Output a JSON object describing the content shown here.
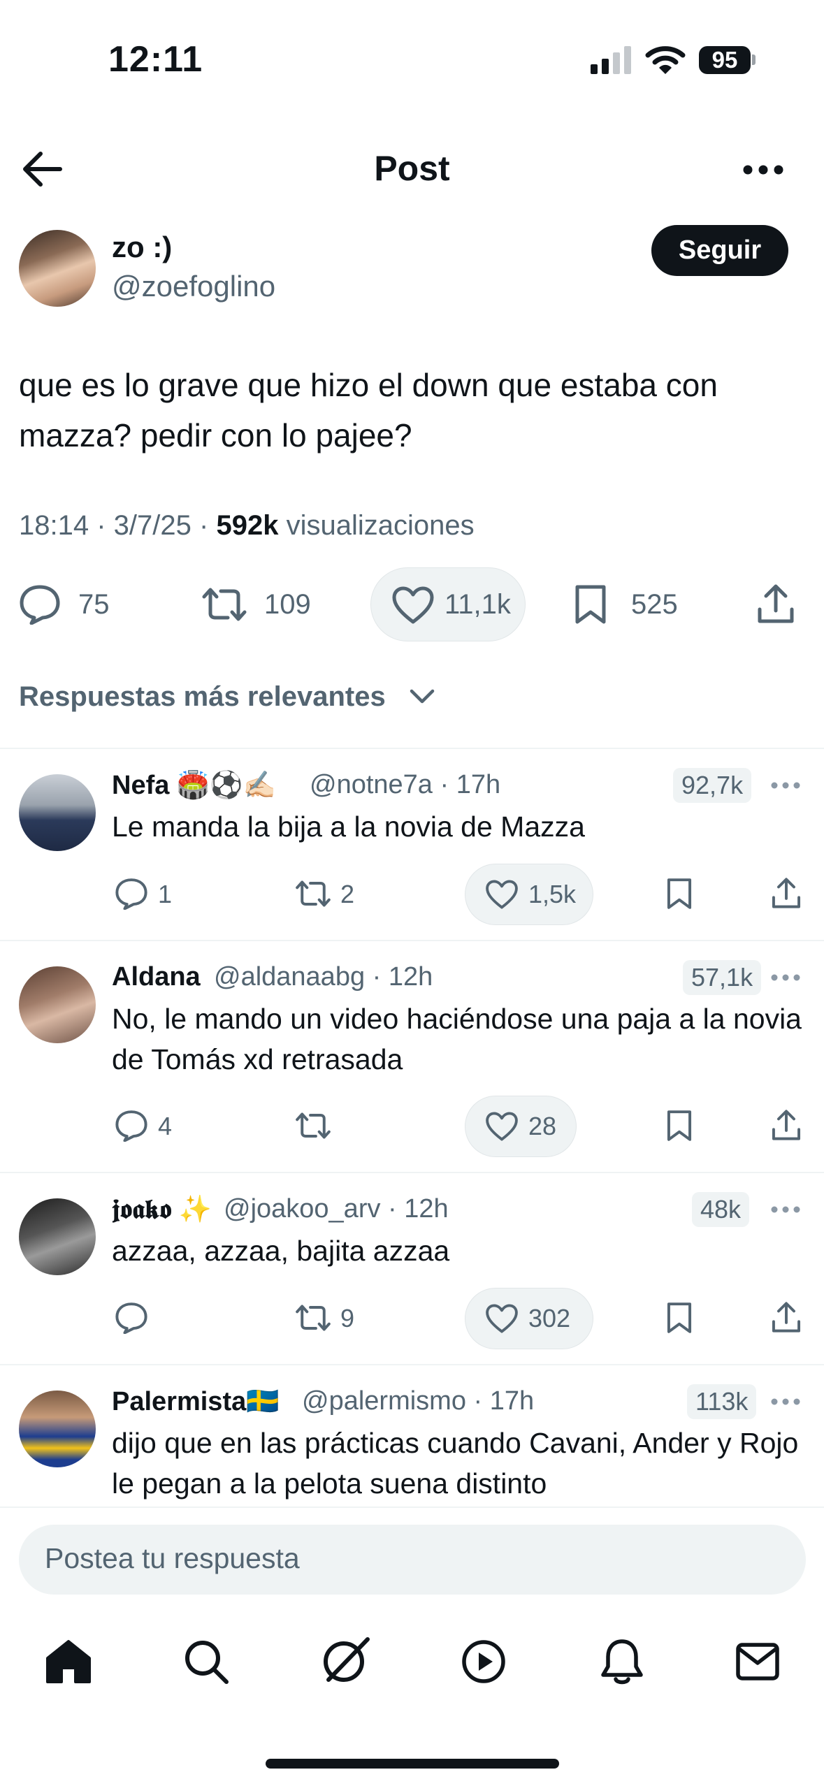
{
  "status_bar": {
    "time": "12:11",
    "battery": "95"
  },
  "header": {
    "title": "Post"
  },
  "post": {
    "author_name": "zo :)",
    "author_handle": "@zoefoglino",
    "follow_label": "Seguir",
    "text": "que es lo grave que hizo el down que estaba con mazza? pedir con lo pajee?",
    "time": "18:14",
    "date": "3/7/25",
    "views": "592k",
    "views_label": "visualizaciones",
    "replies": "75",
    "reposts": "109",
    "likes": "11,1k",
    "bookmarks": "525"
  },
  "sort": {
    "label": "Respuestas más relevantes"
  },
  "replies": [
    {
      "name": "Nefa 🏟️⚽✍🏻",
      "handle": "@notne7a · 17h",
      "views": "92,7k",
      "text": "Le manda la bija a la novia de Mazza",
      "replies": "1",
      "reposts": "2",
      "likes": "1,5k"
    },
    {
      "name": "Aldana",
      "handle": "@aldanaabg · 12h",
      "views": "57,1k",
      "text": "No, le mando un video haciéndose una paja a la novia de Tomás xd retrasada",
      "replies": "4",
      "reposts": "",
      "likes": "28"
    },
    {
      "name": "𝖏𝖔𝖆𝖐𝖔 ✨",
      "handle": "@joakoo_arv · 12h",
      "views": "48k",
      "text": "azzaa, azzaa, bajita azzaa",
      "replies": "",
      "reposts": "9",
      "likes": "302"
    },
    {
      "name": "Palermista🇸🇪",
      "handle": "@palermismo · 17h",
      "views": "113k",
      "text": "dijo que en las prácticas cuando Cavani, Ander y Rojo le pegan a la pelota suena distinto"
    }
  ],
  "compose": {
    "placeholder": "Postea tu respuesta"
  },
  "colors": {
    "text": "#0f1419",
    "secondary": "#536471",
    "pill": "#eff3f4"
  },
  "icons": {
    "header": [
      "back-arrow-icon",
      "more-icon"
    ],
    "actions": [
      "reply-icon",
      "repost-icon",
      "like-icon",
      "bookmark-icon",
      "share-icon"
    ],
    "tabbar": [
      "home-icon",
      "search-icon",
      "grok-icon",
      "video-icon",
      "notifications-icon",
      "messages-icon"
    ]
  }
}
